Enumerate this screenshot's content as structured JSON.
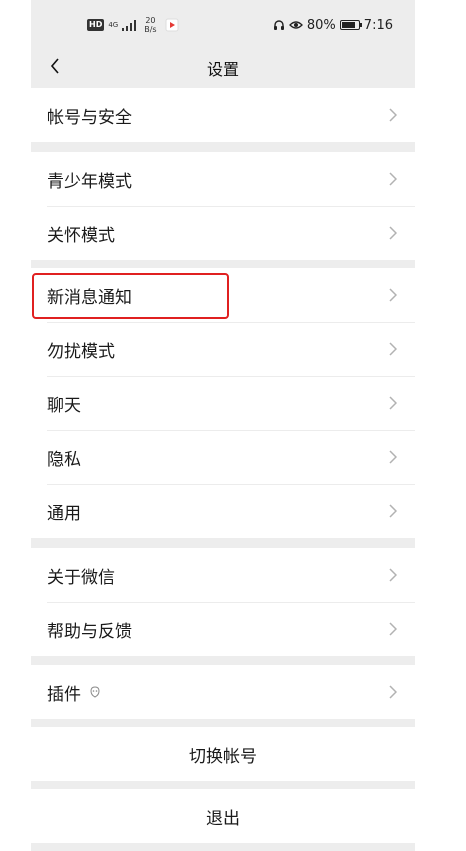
{
  "status_bar": {
    "hd": "HD",
    "net": "4G",
    "speed_value": "20",
    "speed_unit": "B/s",
    "battery_percent": "80%",
    "battery_level": 0.8,
    "time": "7:16"
  },
  "nav": {
    "title": "设置"
  },
  "groups": {
    "account": [
      "帐号与安全"
    ],
    "care": [
      "青少年模式",
      "关怀模式"
    ],
    "general": [
      "新消息通知",
      "勿扰模式",
      "聊天",
      "隐私",
      "通用"
    ],
    "about": [
      "关于微信",
      "帮助与反馈"
    ],
    "plugins": [
      "插件"
    ]
  },
  "actions": {
    "switch_account": "切换帐号",
    "logout": "退出"
  },
  "colors": {
    "background": "#ededed",
    "card": "#ffffff",
    "highlight": "#e02020"
  }
}
